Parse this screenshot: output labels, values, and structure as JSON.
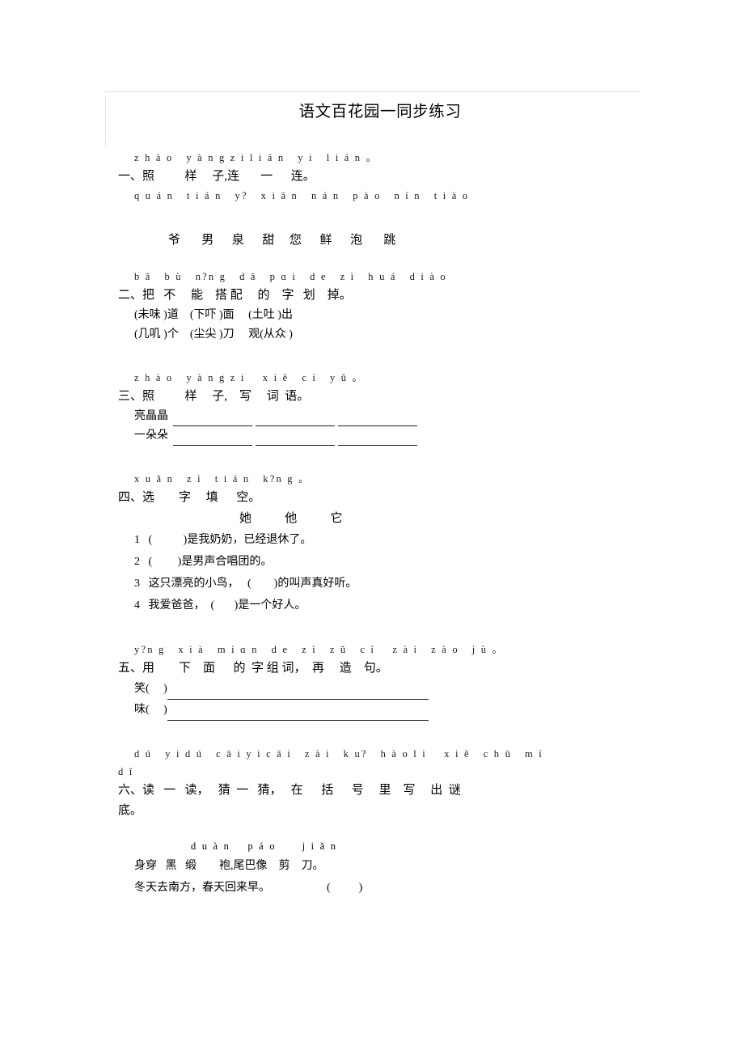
{
  "document": {
    "title": "语文百花园一同步练习"
  },
  "sections": [
    {
      "id": "section-1",
      "pinyin_head": "z h à o   y à n g z i l i á n   y i   l i á n 。",
      "heading": "一、照          样     子,连       一      连。",
      "bank_pinyin": "q u á n   t i á n   y?   x i ā n   n á n   p à o   n í n   t i à o",
      "bank_hanzi": "爷       男      泉      甜     您      鲜      泡       跳"
    },
    {
      "id": "section-2",
      "pinyin_head": "b ǎ   b ù   n?n g   d ā   p ɑ i   d e   z ì   h u á   d i à o",
      "heading": "二、把   不     能    搭 配     的    字   划    掉。",
      "choices": [
        "(未味 )道    (下吓 )面     (土吐 )出",
        "(几叽 )个    (尘尖 )刀     观(从众 )"
      ]
    },
    {
      "id": "section-3",
      "pinyin_head": "z h à o   y à n g z i    x i ě   c í   y ǔ 。",
      "heading": "三、照          样     子,    写     词  语。",
      "blank_rows": [
        {
          "lead": "亮晶晶",
          "blanks": 3
        },
        {
          "lead": "一朵朵",
          "blanks": 3
        }
      ]
    },
    {
      "id": "section-4",
      "pinyin_head": "x u ǎ n   z ì   t i á n   k?n g 。",
      "heading": "四、选        字     填      空。",
      "pronouns": "她           他           它",
      "items": [
        "1   (           )是我奶奶，已经退休了。",
        "2   (         )是男声合唱团的。",
        "3   这只漂亮的小鸟，   (        )的叫声真好听。",
        "4   我爱爸爸，  (       )是一个好人。"
      ]
    },
    {
      "id": "section-5",
      "pinyin_head": "y?n g   x i à   m i ɑ n   d e   z ì   z ǔ   c í    z à i   z à o   j ù 。",
      "heading": "五、用        下    面      的  字 组 词，  再     造    句。",
      "compose_rows": [
        {
          "lead": "笑(     )"
        },
        {
          "lead": "味(     )"
        }
      ]
    },
    {
      "id": "section-6",
      "pinyin_head_1": "d ú   y i d ú   c ā i y i c ā i   z à i   k u?   h à o l i    x i ě   c h ū   m í",
      "pinyin_head_2": "d ǐ",
      "heading_1": "六、读   一   读，   猜  一   猜，   在      括      号     里    写     出  谜",
      "heading_2": "底。",
      "riddle_pinyin": "d u à n    p á o      j i ǎ n",
      "riddle_line_1": "身穿   黑   缎        袍,尾巴像    剪    刀。",
      "riddle_line_2": "冬天去南方，春天回来早。                    (          )"
    }
  ]
}
